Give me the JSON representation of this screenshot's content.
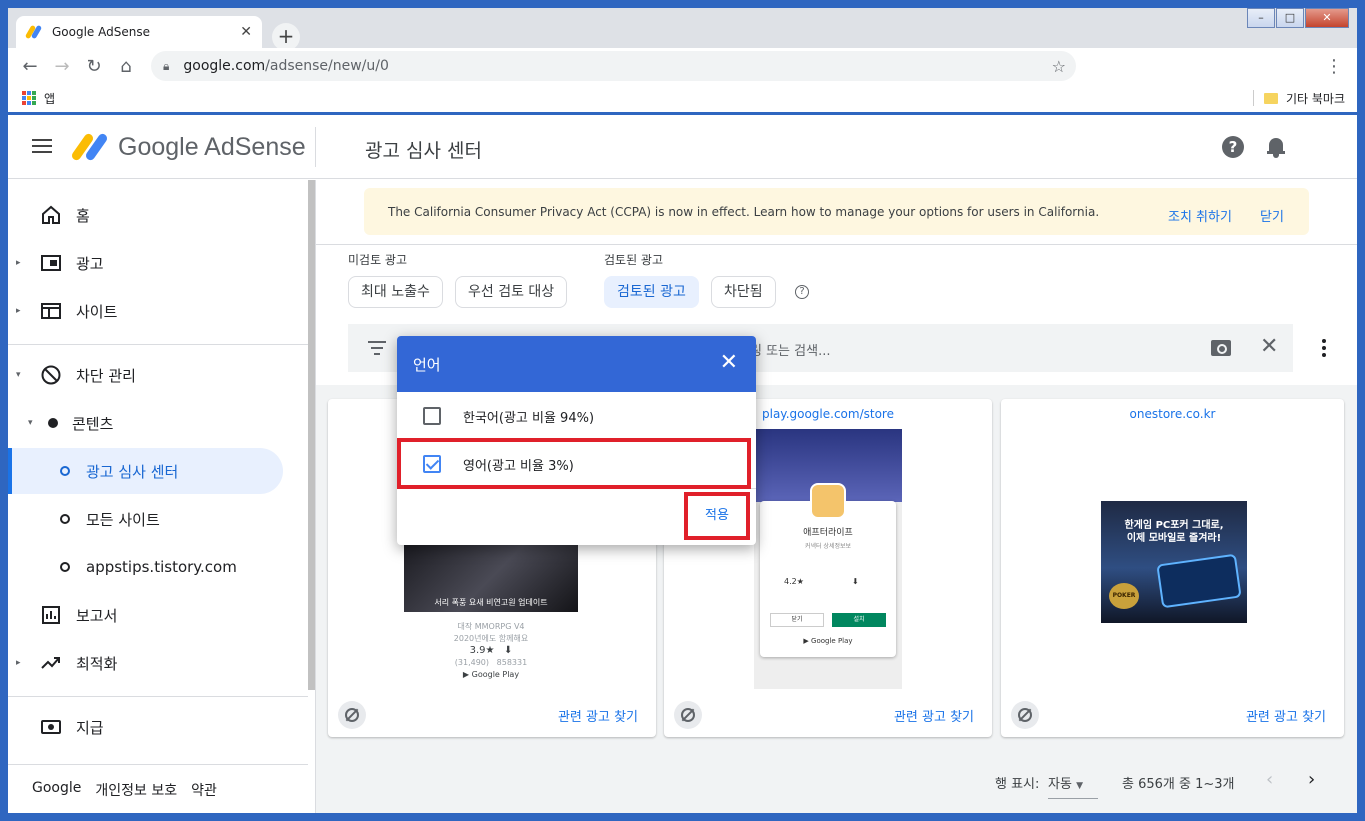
{
  "browser": {
    "tab_title": "Google AdSense",
    "url_host": "google.com",
    "url_path": "/adsense/new/u/0",
    "apps_label": "앱",
    "other_bookmarks": "기타 북마크"
  },
  "header": {
    "brand": "Google AdSense",
    "page_title": "광고 심사 센터"
  },
  "sidebar": {
    "items": [
      {
        "label": "홈"
      },
      {
        "label": "광고"
      },
      {
        "label": "사이트"
      },
      {
        "label": "차단 관리"
      },
      {
        "label": "콘텐츠"
      },
      {
        "label": "광고 심사 센터"
      },
      {
        "label": "모든 사이트"
      },
      {
        "label": "appstips.tistory.com"
      },
      {
        "label": "보고서"
      },
      {
        "label": "최적화"
      },
      {
        "label": "지급"
      }
    ],
    "footer": [
      "Google",
      "개인정보 보호",
      "약관"
    ]
  },
  "banner": {
    "message": "The California Consumer Privacy Act (CCPA) is now in effect. Learn how to manage your options for users in California.",
    "action": "조치 취하기",
    "dismiss": "닫기"
  },
  "filters": {
    "unreviewed_label": "미검토 광고",
    "reviewed_label": "검토된 광고",
    "chips": [
      "최대 노출수",
      "우선 검토 대상",
      "검토된 광고",
      "차단됨"
    ],
    "search_placeholder": "링 또는 검색..."
  },
  "cards": [
    {
      "domain": "",
      "ad_caption": "서리 폭풍 요새 비연고원 업데이트",
      "meta_line1": "대작 MMORPG V4",
      "meta_line2": "2020년에도 함께해요",
      "rating": "3.9★",
      "reviews": "(31,490)",
      "downloads": "858331",
      "store": "Google Play",
      "related": "관련 광고 찾기"
    },
    {
      "domain": "play.google.com/store",
      "app_name": "애프터라이프",
      "app_sub": "커넥터 상세정보보",
      "rating": "4.2★",
      "cancel": "닫기",
      "install": "설치",
      "store": "Google Play",
      "related": "관련 광고 찾기"
    },
    {
      "domain": "onestore.co.kr",
      "ad_text_line1": "한게임 PC포커 그대로,",
      "ad_text_line2": "이제 모바일로 즐겨라!",
      "badge": "POKER",
      "related": "관련 광고 찾기"
    }
  ],
  "pagination": {
    "rows_label": "행 표시:",
    "rows_value": "자동",
    "summary": "총 656개 중 1~3개"
  },
  "dialog": {
    "title": "언어",
    "options": [
      {
        "label": "한국어(광고 비율 94%)",
        "checked": false
      },
      {
        "label": "영어(광고 비율 3%)",
        "checked": true
      }
    ],
    "apply": "적용"
  },
  "colors": {
    "accent": "#1a73e8",
    "dialog_header": "#3367d6",
    "highlight": "#e0202a",
    "banner_bg": "#fef7e0"
  }
}
